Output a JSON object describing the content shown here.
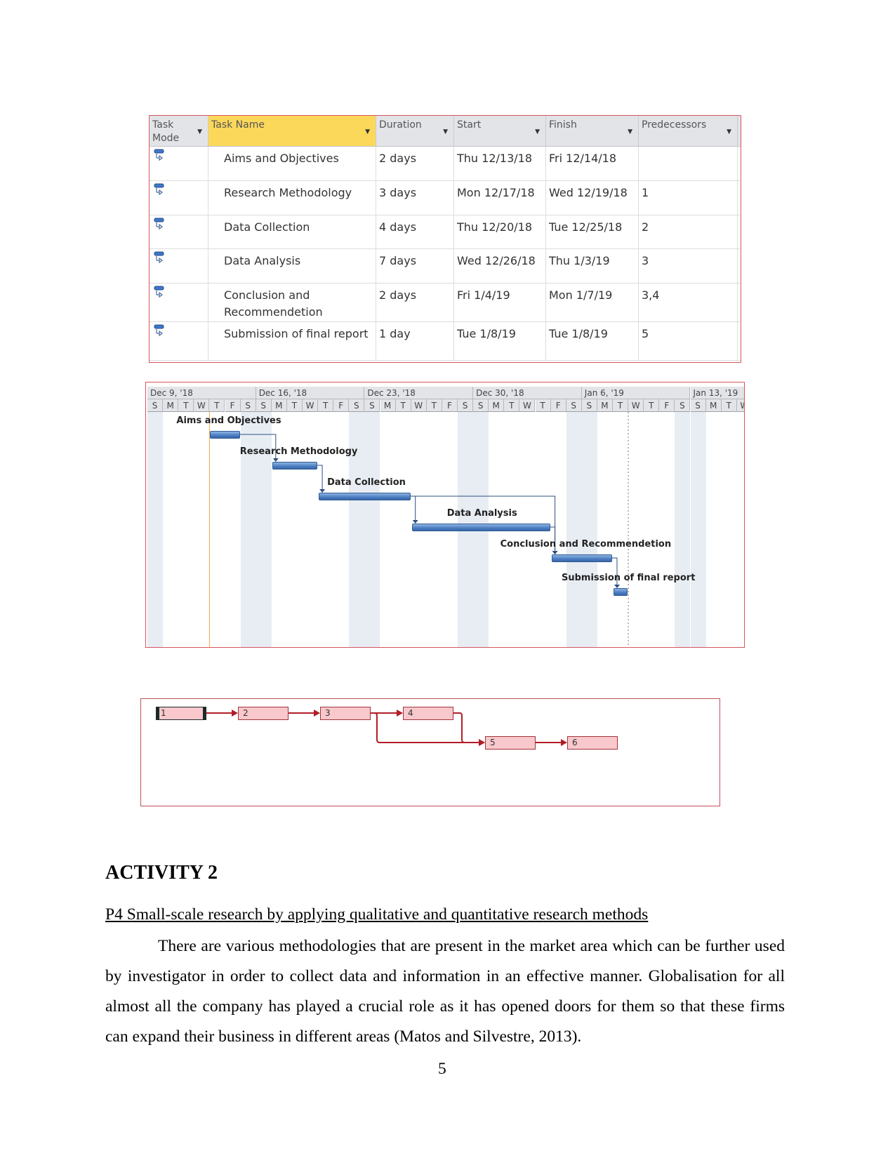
{
  "task_table": {
    "columns": [
      {
        "label": "Task Mode"
      },
      {
        "label": "Task Name"
      },
      {
        "label": "Duration"
      },
      {
        "label": "Start"
      },
      {
        "label": "Finish"
      },
      {
        "label": "Predecessors"
      }
    ],
    "rows": [
      {
        "mode": "auto-scheduled-icon",
        "name": "Aims and Objectives",
        "duration": "2 days",
        "start": "Thu 12/13/18",
        "finish": "Fri 12/14/18",
        "predecessors": ""
      },
      {
        "mode": "auto-scheduled-icon",
        "name": "Research Methodology",
        "duration": "3 days",
        "start": "Mon 12/17/18",
        "finish": "Wed 12/19/18",
        "predecessors": "1"
      },
      {
        "mode": "auto-scheduled-icon",
        "name": "Data Collection",
        "duration": "4 days",
        "start": "Thu 12/20/18",
        "finish": "Tue 12/25/18",
        "predecessors": "2"
      },
      {
        "mode": "auto-scheduled-icon",
        "name": "Data Analysis",
        "duration": "7 days",
        "start": "Wed 12/26/18",
        "finish": "Thu 1/3/19",
        "predecessors": "3"
      },
      {
        "mode": "auto-scheduled-icon",
        "name": "Conclusion and Recommendetion",
        "duration": "2 days",
        "start": "Fri 1/4/19",
        "finish": "Mon 1/7/19",
        "predecessors": "3,4"
      },
      {
        "mode": "auto-scheduled-icon",
        "name": "Submission of final report",
        "duration": "1 day",
        "start": "Tue 1/8/19",
        "finish": "Tue 1/8/19",
        "predecessors": "5"
      }
    ]
  },
  "gantt": {
    "weeks": [
      "Dec 9, '18",
      "Dec 16, '18",
      "Dec 23, '18",
      "Dec 30, '18",
      "Jan 6, '19",
      "Jan 13, '19"
    ],
    "day_letters": [
      "S",
      "M",
      "T",
      "W",
      "T",
      "F",
      "S"
    ],
    "timeline_start": "2018-12-09",
    "project_start": "2018-12-13",
    "status_date": "2019-01-09",
    "bar_color": "#4a7cc0",
    "tasks": [
      {
        "id": 1,
        "label": "Aims and Objectives",
        "start": "2018-12-13",
        "finish": "2018-12-14",
        "preds": []
      },
      {
        "id": 2,
        "label": "Research Methodology",
        "start": "2018-12-17",
        "finish": "2018-12-19",
        "preds": [
          1
        ]
      },
      {
        "id": 3,
        "label": "Data Collection",
        "start": "2018-12-20",
        "finish": "2018-12-25",
        "preds": [
          2
        ]
      },
      {
        "id": 4,
        "label": "Data Analysis",
        "start": "2018-12-26",
        "finish": "2019-01-03",
        "preds": [
          3
        ]
      },
      {
        "id": 5,
        "label": "Conclusion and Recommendetion",
        "start": "2019-01-04",
        "finish": "2019-01-07",
        "preds": [
          3,
          4
        ]
      },
      {
        "id": 6,
        "label": "Submission of final report",
        "start": "2019-01-08",
        "finish": "2019-01-08",
        "preds": [
          5
        ]
      }
    ]
  },
  "network": {
    "nodes": [
      {
        "id": "1"
      },
      {
        "id": "2"
      },
      {
        "id": "3"
      },
      {
        "id": "4"
      },
      {
        "id": "5"
      },
      {
        "id": "6"
      }
    ],
    "node_color": "#f8c8cc",
    "link_color": "#b01e26"
  },
  "document": {
    "heading": "ACTIVITY 2",
    "subheading": "P4 Small-scale research by applying qualitative and quantitative research methods",
    "paragraph": "There are various methodologies that are present in the market area which can be further used by investigator in order to collect data and information in an effective manner. Globalisation for all almost all the company has played a crucial role as it has opened doors for them so that these firms can expand their business in different areas  (Matos and Silvestre, 2013).",
    "page_number": "5"
  }
}
